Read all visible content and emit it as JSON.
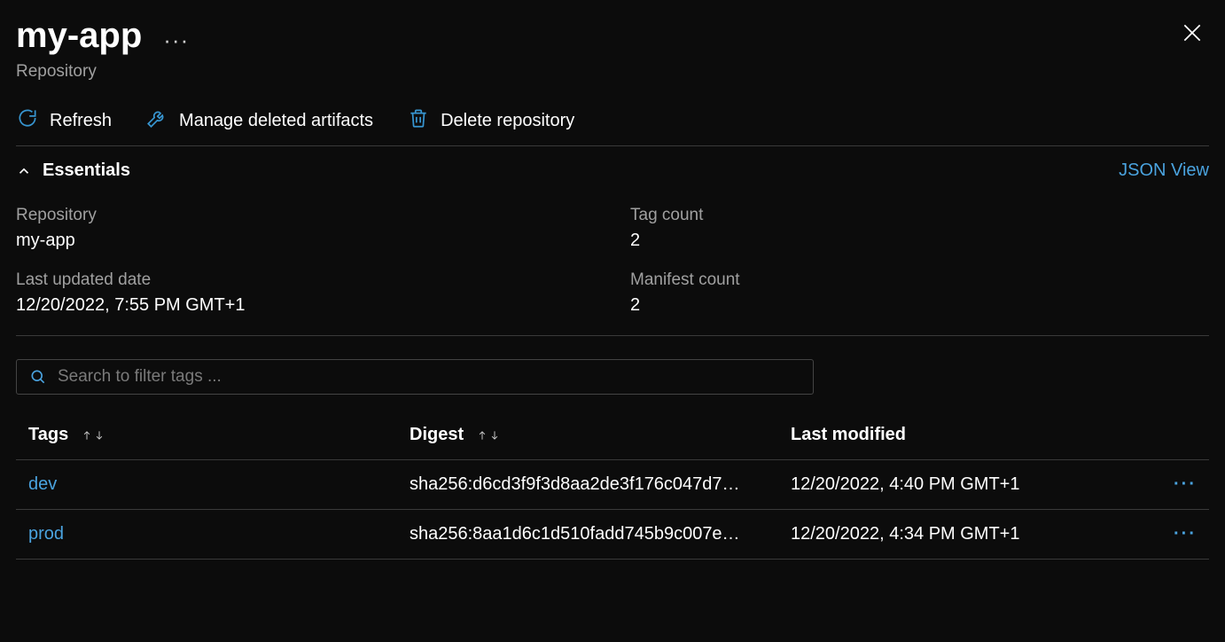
{
  "header": {
    "title": "my-app",
    "subtitle": "Repository"
  },
  "toolbar": {
    "refresh": "Refresh",
    "manage_deleted": "Manage deleted artifacts",
    "delete_repo": "Delete repository"
  },
  "essentials": {
    "label": "Essentials",
    "json_view": "JSON View",
    "fields": {
      "repository_label": "Repository",
      "repository_value": "my-app",
      "tag_count_label": "Tag count",
      "tag_count_value": "2",
      "last_updated_label": "Last updated date",
      "last_updated_value": "12/20/2022, 7:55 PM GMT+1",
      "manifest_count_label": "Manifest count",
      "manifest_count_value": "2"
    }
  },
  "search": {
    "placeholder": "Search to filter tags ..."
  },
  "table": {
    "columns": {
      "tags": "Tags",
      "digest": "Digest",
      "last_modified": "Last modified"
    },
    "rows": [
      {
        "tag": "dev",
        "digest": "sha256:d6cd3f9f3d8aa2de3f176c047d7…",
        "last_modified": "12/20/2022, 4:40 PM GMT+1"
      },
      {
        "tag": "prod",
        "digest": "sha256:8aa1d6c1d510fadd745b9c007e…",
        "last_modified": "12/20/2022, 4:34 PM GMT+1"
      }
    ]
  },
  "glyphs": {
    "ellipsis": "···"
  }
}
